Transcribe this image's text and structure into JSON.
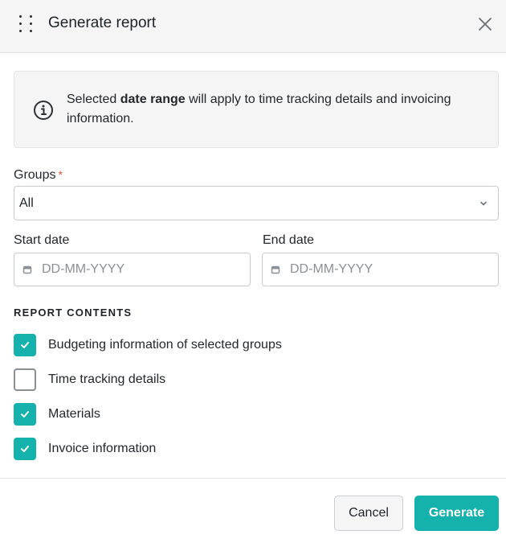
{
  "dialog": {
    "title": "Generate report",
    "icons": {
      "drag": "drag-handle-icon",
      "close": "close-icon"
    }
  },
  "info": {
    "text_before": "Selected ",
    "text_bold": "date range",
    "text_after": " will apply to time tracking details and invoicing information.",
    "icon": "info-icon"
  },
  "groups": {
    "label": "Groups",
    "required_mark": "*",
    "value": "All"
  },
  "start_date": {
    "label": "Start date",
    "placeholder": "DD-MM-YYYY",
    "value": ""
  },
  "end_date": {
    "label": "End date",
    "placeholder": "DD-MM-YYYY",
    "value": ""
  },
  "report_contents": {
    "heading": "REPORT CONTENTS",
    "items": [
      {
        "label": "Budgeting information of selected groups",
        "checked": true
      },
      {
        "label": "Time tracking details",
        "checked": false
      },
      {
        "label": "Materials",
        "checked": true
      },
      {
        "label": "Invoice information",
        "checked": true
      }
    ]
  },
  "actions": {
    "cancel": "Cancel",
    "generate": "Generate"
  },
  "colors": {
    "accent": "#14b1ad",
    "required": "#e0563b",
    "header_bg": "#f5f5f6"
  }
}
